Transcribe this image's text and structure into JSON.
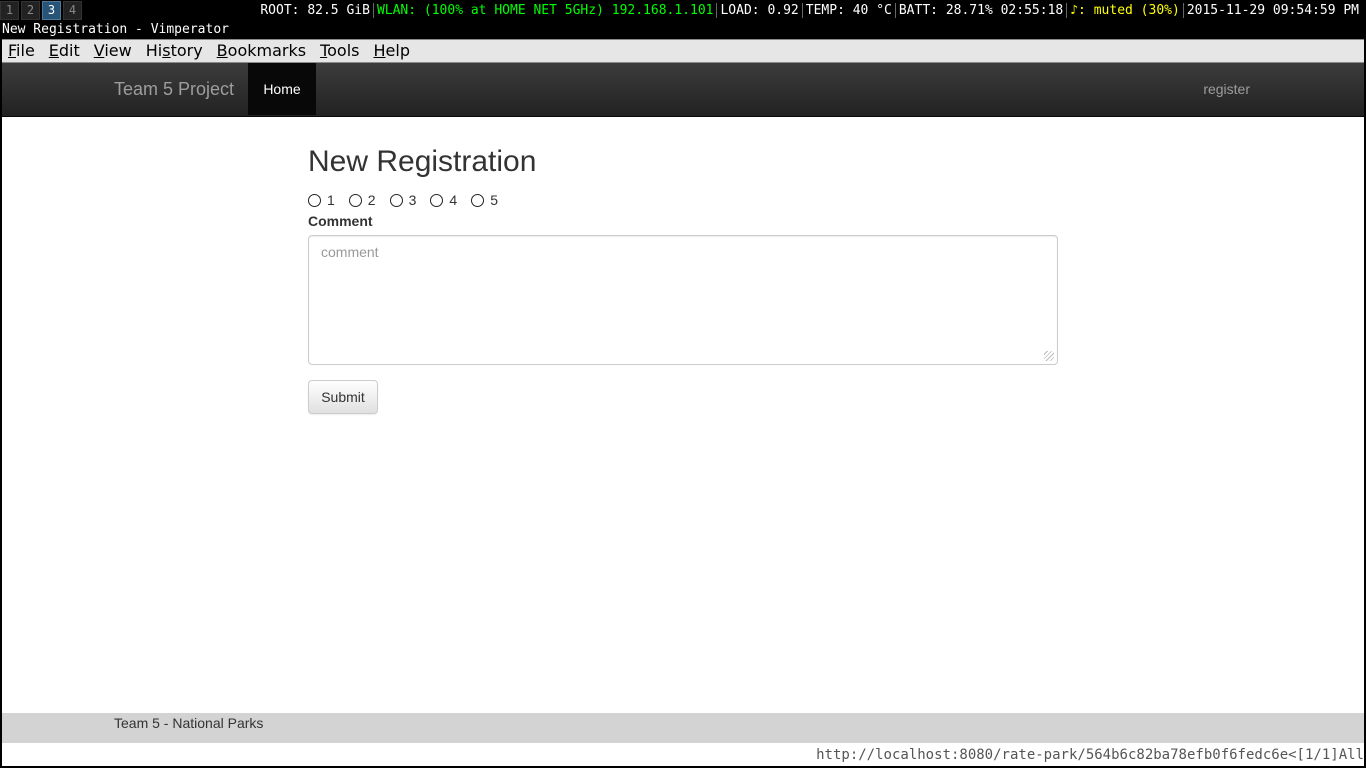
{
  "statusbar": {
    "workspaces": [
      "1",
      "2",
      "3",
      "4"
    ],
    "active_workspace": "3",
    "root": "ROOT: 82.5 GiB",
    "wlan": "WLAN: (100% at HOME NET 5GHz) 192.168.1.101",
    "load": "LOAD: 0.92",
    "temp": "TEMP: 40 °C",
    "batt": "BATT: 28.71% 02:55:18",
    "audio": "♪: muted (30%)",
    "datetime": "2015-11-29 09:54:59 PM",
    "colors": {
      "wlan": "#00ff00",
      "audio": "#ffff00",
      "active_ws": "#285577"
    }
  },
  "window": {
    "title": "New Registration - Vimperator"
  },
  "menubar": {
    "items": [
      "File",
      "Edit",
      "View",
      "History",
      "Bookmarks",
      "Tools",
      "Help"
    ],
    "accelerators": [
      "F",
      "E",
      "V",
      "s",
      "B",
      "T",
      "H"
    ]
  },
  "navbar": {
    "brand": "Team 5 Project",
    "home": "Home",
    "register": "register"
  },
  "main": {
    "title": "New Registration",
    "rating_options": [
      "1",
      "2",
      "3",
      "4",
      "5"
    ],
    "comment_label": "Comment",
    "comment_placeholder": "comment",
    "comment_value": "",
    "submit_label": "Submit"
  },
  "footer": {
    "text": "Team 5 - National Parks"
  },
  "vimperator": {
    "url": "http://localhost:8080/rate-park/564b6c82ba78efb0f6fedc6e",
    "indicator": "<[1/1]",
    "position": "All"
  }
}
